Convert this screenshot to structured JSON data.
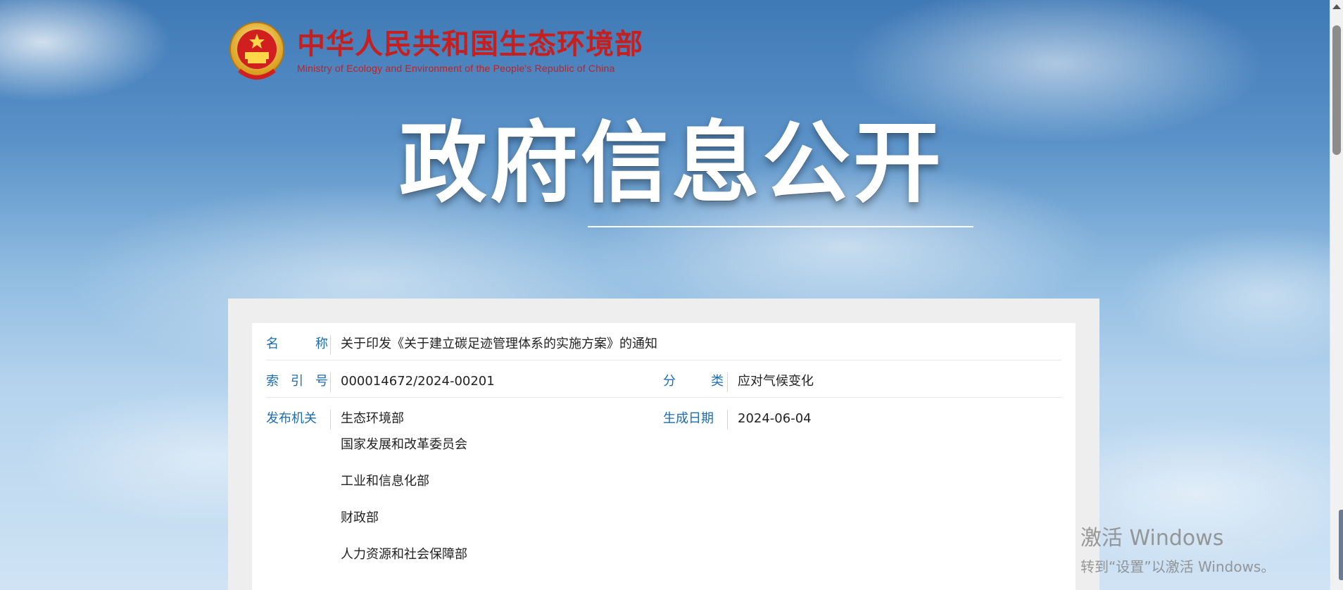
{
  "header": {
    "org_name_cn": "中华人民共和国生态环境部",
    "org_name_en": "Ministry of Ecology and Environment of the People's Republic of China",
    "emblem_icon": "national-emblem-icon"
  },
  "hero": {
    "title": "政府信息公开"
  },
  "info": {
    "name_label": [
      "名",
      "称"
    ],
    "name_value": "关于印发《关于建立碳足迹管理体系的实施方案》的通知",
    "index_label": [
      "索",
      "引",
      "号"
    ],
    "index_value": "000014672/2024-00201",
    "category_label": [
      "分",
      "类"
    ],
    "category_value": "应对气候变化",
    "publisher_label": "发布机关",
    "publishers": [
      "生态环境部",
      "国家发展和改革委员会",
      "工业和信息化部",
      "财政部",
      "人力资源和社会保障部"
    ],
    "date_label": "生成日期",
    "date_value": "2024-06-04"
  },
  "watermark": {
    "title": "激活 Windows",
    "subtitle": "转到“设置”以激活 Windows。"
  },
  "colors": {
    "label_blue": "#1b6cb1",
    "brand_red": "#c71e1e",
    "sky_top": "#3f79b6",
    "sky_bottom": "#cfe3f4"
  }
}
